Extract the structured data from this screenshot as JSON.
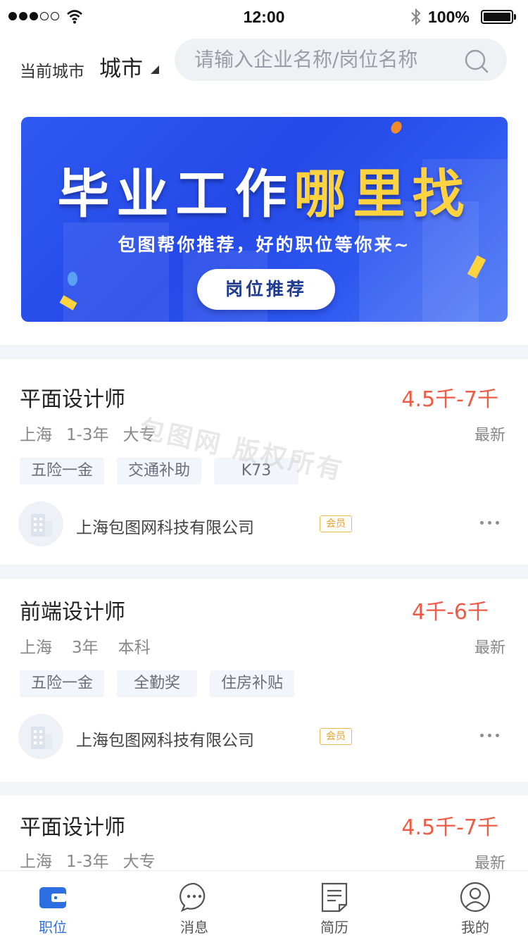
{
  "status_bar": {
    "time": "12:00",
    "battery": "100%",
    "icons": [
      "signal-dots",
      "wifi-icon",
      "bluetooth-icon",
      "battery-icon"
    ]
  },
  "header": {
    "city_label": "当前城市",
    "city_value": "城市",
    "search_placeholder": "请输入企业名称/岗位名称",
    "search_icon": "search-icon"
  },
  "banner": {
    "title_white": "毕业工作",
    "title_highlight": "哪里找",
    "subtitle": "包图帮你推荐，好的职位等你来~",
    "button_label": "岗位推荐",
    "colors": {
      "background": "#2a52ee",
      "highlight": "#ffd23f"
    }
  },
  "jobs": [
    {
      "title": "平面设计师",
      "salary": "4.5千-7千",
      "location": "上海",
      "experience": "1-3年",
      "education": "大专",
      "freshness": "最新",
      "tags": [
        "五险一金",
        "交通补助",
        "K73"
      ],
      "company": "上海包图网科技有限公司",
      "badge": "会员"
    },
    {
      "title": "前端设计师",
      "salary": "4千-6千",
      "location": "上海",
      "experience": "3年",
      "education": "本科",
      "freshness": "最新",
      "tags": [
        "五险一金",
        "全勤奖",
        "住房补贴"
      ],
      "company": "上海包图网科技有限公司",
      "badge": "会员"
    },
    {
      "title": "平面设计师",
      "salary": "4.5千-7千",
      "location": "上海",
      "experience": "1-3年",
      "education": "大专",
      "freshness": "最新"
    }
  ],
  "watermark": "包图网 版权所有",
  "bottom_nav": [
    {
      "label": "职位",
      "icon": "wallet-icon",
      "active": true
    },
    {
      "label": "消息",
      "icon": "chat-bubble-icon",
      "active": false
    },
    {
      "label": "简历",
      "icon": "document-icon",
      "active": false
    },
    {
      "label": "我的",
      "icon": "user-icon",
      "active": false
    }
  ],
  "colors": {
    "accent": "#2c6fe3",
    "salary": "#ef5b46",
    "vip": "#eba22d"
  }
}
